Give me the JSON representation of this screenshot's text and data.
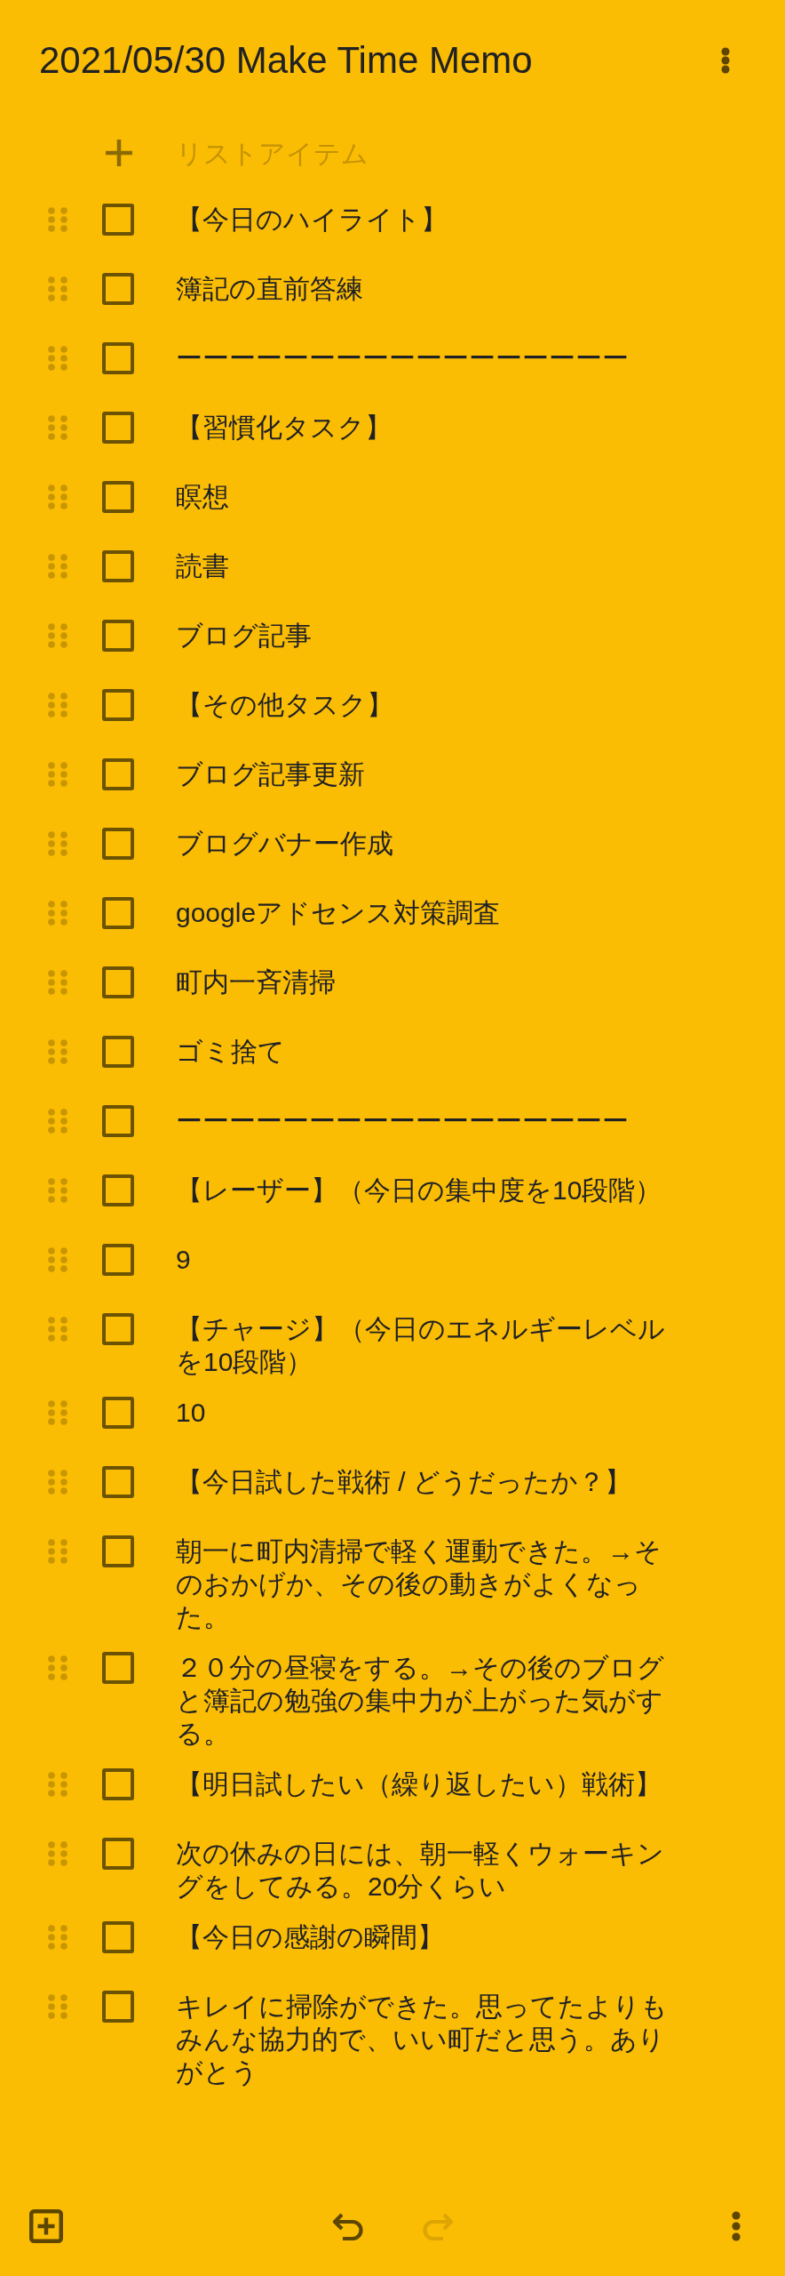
{
  "note": {
    "title": "2021/05/30 Make Time Memo"
  },
  "add_item": {
    "placeholder": "リストアイテム"
  },
  "items": [
    {
      "text": "【今日のハイライト】",
      "checked": false
    },
    {
      "text": "簿記の直前答練",
      "checked": false
    },
    {
      "text": "ーーーーーーーーーーーーーーーーー",
      "checked": false
    },
    {
      "text": "【習慣化タスク】",
      "checked": false
    },
    {
      "text": "瞑想",
      "checked": false
    },
    {
      "text": "読書",
      "checked": false
    },
    {
      "text": "ブログ記事",
      "checked": false
    },
    {
      "text": "【その他タスク】",
      "checked": false
    },
    {
      "text": "ブログ記事更新",
      "checked": false
    },
    {
      "text": "ブログバナー作成",
      "checked": false
    },
    {
      "text": "googleアドセンス対策調査",
      "checked": false
    },
    {
      "text": "町内一斉清掃",
      "checked": false
    },
    {
      "text": "ゴミ捨て",
      "checked": false
    },
    {
      "text": "ーーーーーーーーーーーーーーーーー",
      "checked": false
    },
    {
      "text": "【レーザー】（今日の集中度を10段階）",
      "checked": false
    },
    {
      "text": "9",
      "checked": false
    },
    {
      "text": "【チャージ】（今日のエネルギーレベルを10段階）",
      "checked": false
    },
    {
      "text": "10",
      "checked": false
    },
    {
      "text": "【今日試した戦術 / どうだったか？】",
      "checked": false
    },
    {
      "text": "朝一に町内清掃で軽く運動できた。→そのおかげか、その後の動きがよくなった。",
      "checked": false
    },
    {
      "text": "２０分の昼寝をする。→その後のブログと簿記の勉強の集中力が上がった気がする。",
      "checked": false
    },
    {
      "text": "【明日試したい（繰り返したい）戦術】",
      "checked": false
    },
    {
      "text": "次の休みの日には、朝一軽くウォーキングをしてみる。20分くらい",
      "checked": false
    },
    {
      "text": "【今日の感謝の瞬間】",
      "checked": false
    },
    {
      "text": "キレイに掃除ができた。思ってたよりもみんな協力的で、いい町だと思う。ありがとう",
      "checked": false
    }
  ],
  "bottom_bar": {
    "left": [
      {
        "kind": "add"
      }
    ],
    "center": [
      {
        "kind": "undo",
        "disabled": false
      },
      {
        "kind": "redo",
        "disabled": true
      }
    ],
    "right": [
      {
        "kind": "more"
      }
    ]
  }
}
